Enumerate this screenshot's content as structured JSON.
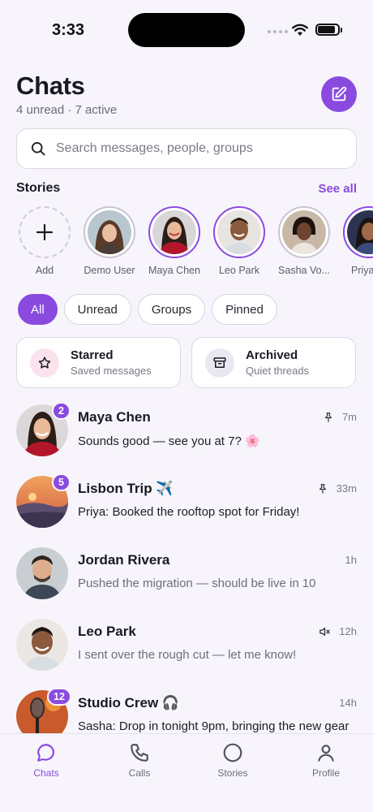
{
  "status_bar": {
    "time": "3:33"
  },
  "header": {
    "title": "Chats",
    "subtitle": "4 unread · 7 active",
    "compose_icon": "compose-icon"
  },
  "search": {
    "placeholder": "Search messages, people, groups",
    "value": ""
  },
  "stories": {
    "title": "Stories",
    "see_all": "See all",
    "items": [
      {
        "label": "Add",
        "kind": "add"
      },
      {
        "label": "Demo User",
        "seen": true
      },
      {
        "label": "Maya Chen",
        "seen": false
      },
      {
        "label": "Leo Park",
        "seen": false
      },
      {
        "label": "Sasha Vo...",
        "seen": true
      },
      {
        "label": "Priya K",
        "seen": false
      }
    ]
  },
  "filters": {
    "items": [
      "All",
      "Unread",
      "Groups",
      "Pinned"
    ],
    "selected": "All"
  },
  "quick_cards": [
    {
      "title": "Starred",
      "subtitle": "Saved messages",
      "icon": "star-icon"
    },
    {
      "title": "Archived",
      "subtitle": "Quiet threads",
      "icon": "archive-icon"
    }
  ],
  "chats": [
    {
      "name": "Maya Chen",
      "preview": "Sounds good — see you at 7? 🌸",
      "time": "7m",
      "unread": "2",
      "pinned": true,
      "muted": false
    },
    {
      "name": "Lisbon Trip ✈️",
      "preview": "Priya: Booked the rooftop spot for Friday!",
      "time": "33m",
      "unread": "5",
      "pinned": true,
      "muted": false
    },
    {
      "name": "Jordan Rivera",
      "preview": "Pushed the migration — should be live in 10",
      "time": "1h",
      "unread": "",
      "pinned": false,
      "muted": false
    },
    {
      "name": "Leo Park",
      "preview": "I sent over the rough cut — let me know!",
      "time": "12h",
      "unread": "",
      "pinned": false,
      "muted": true
    },
    {
      "name": "Studio Crew 🎧",
      "preview": "Sasha: Drop in tonight 9pm, bringing the new gear",
      "time": "14h",
      "unread": "12",
      "pinned": false,
      "muted": false
    }
  ],
  "tabs": [
    {
      "label": "Chats",
      "icon": "chat-bubble-icon",
      "active": true
    },
    {
      "label": "Calls",
      "icon": "phone-icon",
      "active": false
    },
    {
      "label": "Stories",
      "icon": "circle-icon",
      "active": false
    },
    {
      "label": "Profile",
      "icon": "person-icon",
      "active": false
    }
  ],
  "colors": {
    "accent": "#8a4ae0",
    "background": "#f7f5fb"
  }
}
